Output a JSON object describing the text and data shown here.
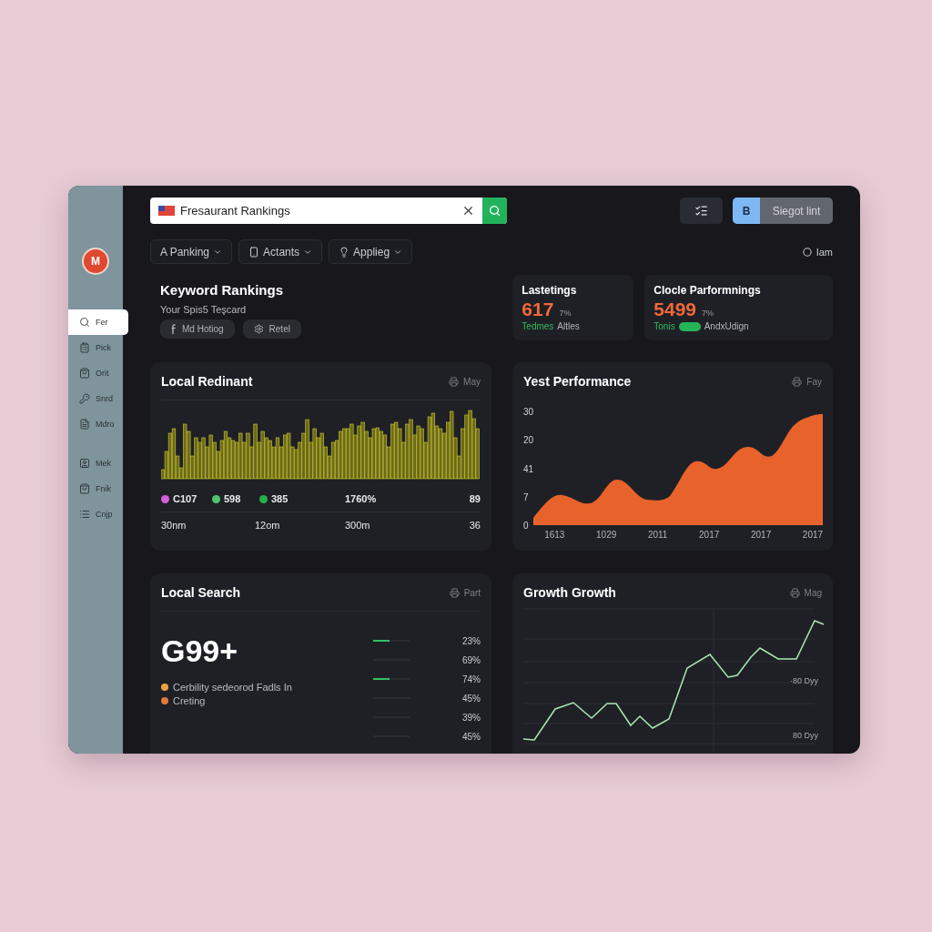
{
  "search": {
    "value": "Fresaurant Rankings"
  },
  "toolbar": {
    "badge": "B",
    "label": "Siegot lint"
  },
  "sidebar": {
    "logo": "M",
    "items": [
      {
        "label": "Fer",
        "selected": true
      },
      {
        "label": "Pick",
        "selected": false
      },
      {
        "label": "Orit",
        "selected": false
      },
      {
        "label": "Snrd",
        "selected": false
      },
      {
        "label": "Mdro",
        "selected": false
      },
      {
        "label": "Mek",
        "selected": false
      },
      {
        "label": "Fnik",
        "selected": false
      },
      {
        "label": "Cnjp",
        "selected": false
      }
    ]
  },
  "filters": [
    {
      "label": "A Panking"
    },
    {
      "label": "Actants"
    },
    {
      "label": "Applieg"
    }
  ],
  "user": {
    "label": "Iam"
  },
  "header": {
    "title": "Keyword Rankings",
    "subtitle": "Your Spis5 Teşcard",
    "chips": [
      {
        "label": "Md Hotiog"
      },
      {
        "label": "Retel"
      }
    ]
  },
  "stats": [
    {
      "title": "Lastetings",
      "value": "617",
      "change": "7%",
      "tag": "Tedmes",
      "badge": false,
      "note": "Altles"
    },
    {
      "title": "Clocle Parformnings",
      "value": "5499",
      "change": "7%",
      "tag": "Tonis",
      "badge": true,
      "note": "AndxUdign"
    }
  ],
  "redinant": {
    "title": "Local Redinant",
    "action": "May",
    "row_1": [
      {
        "value": "C107",
        "color": "#d55fd8"
      },
      {
        "value": "598",
        "color": "#4cc470"
      },
      {
        "value": "385",
        "color": "#22b14c"
      },
      {
        "value": "1760%"
      },
      {
        "value": "89"
      }
    ],
    "row_2": [
      "30nm",
      "12om",
      "300m",
      "36"
    ]
  },
  "performance": {
    "title": "Yest Performance",
    "action": "Fay",
    "y_labels": [
      "30",
      "20",
      "41",
      "7",
      "0"
    ],
    "x_labels": [
      "1613",
      "1029",
      "2011",
      "2017",
      "2017",
      "2017"
    ]
  },
  "local_search": {
    "title": "Local Search",
    "action": "Part",
    "big_value": "G99+",
    "legend": [
      {
        "label": "Cerbility sedeorod Fadls In",
        "color": "#f0a040"
      },
      {
        "label": "Creting",
        "color": "#e07a3a"
      }
    ],
    "bars": [
      {
        "level": 0.45,
        "reading": "23%"
      },
      {
        "reading": "69%"
      },
      {
        "level": 0.45,
        "reading": "74%"
      },
      {
        "reading": "45%"
      },
      {
        "reading": "39%"
      },
      {
        "reading": "45%"
      }
    ]
  },
  "growth": {
    "title": "Growth Growth",
    "action": "Mag",
    "labels": [
      "·80 Dyy",
      "80 Dyy"
    ]
  }
}
